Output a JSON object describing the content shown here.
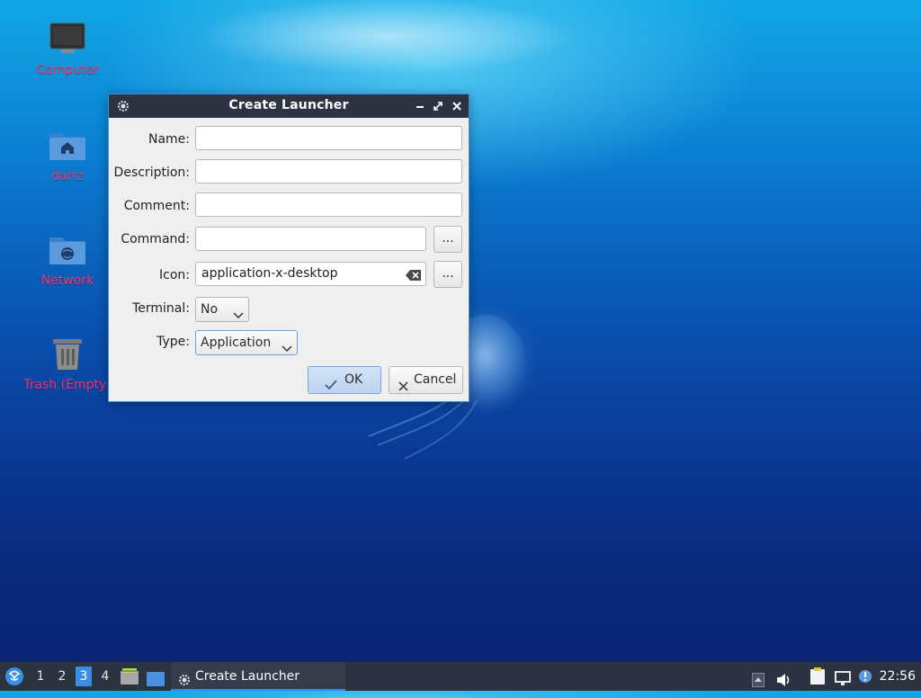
{
  "desktop": {
    "icons": [
      {
        "label": "Computer"
      },
      {
        "label": "dartz"
      },
      {
        "label": "Network"
      },
      {
        "label": "Trash (Empty)"
      }
    ]
  },
  "dialog": {
    "title": "Create Launcher",
    "fields": {
      "name_label": "Name:",
      "name_value": "",
      "description_label": "Description:",
      "description_value": "",
      "comment_label": "Comment:",
      "comment_value": "",
      "command_label": "Command:",
      "command_value": "",
      "command_browse": "...",
      "icon_label": "Icon:",
      "icon_value": "application-x-desktop",
      "icon_browse": "...",
      "terminal_label": "Terminal:",
      "terminal_value": "No",
      "type_label": "Type:",
      "type_value": "Application"
    },
    "buttons": {
      "ok": "OK",
      "cancel": "Cancel"
    }
  },
  "taskbar": {
    "workspaces": [
      "1",
      "2",
      "3",
      "4"
    ],
    "active_workspace": "3",
    "task_label": "Create Launcher",
    "clock": "22:56"
  },
  "colors": {
    "accent": "#3a8ee6",
    "titlebar": "#2c3443",
    "taskbar": "#2b3240",
    "icon_label": "#ff2f6b"
  }
}
